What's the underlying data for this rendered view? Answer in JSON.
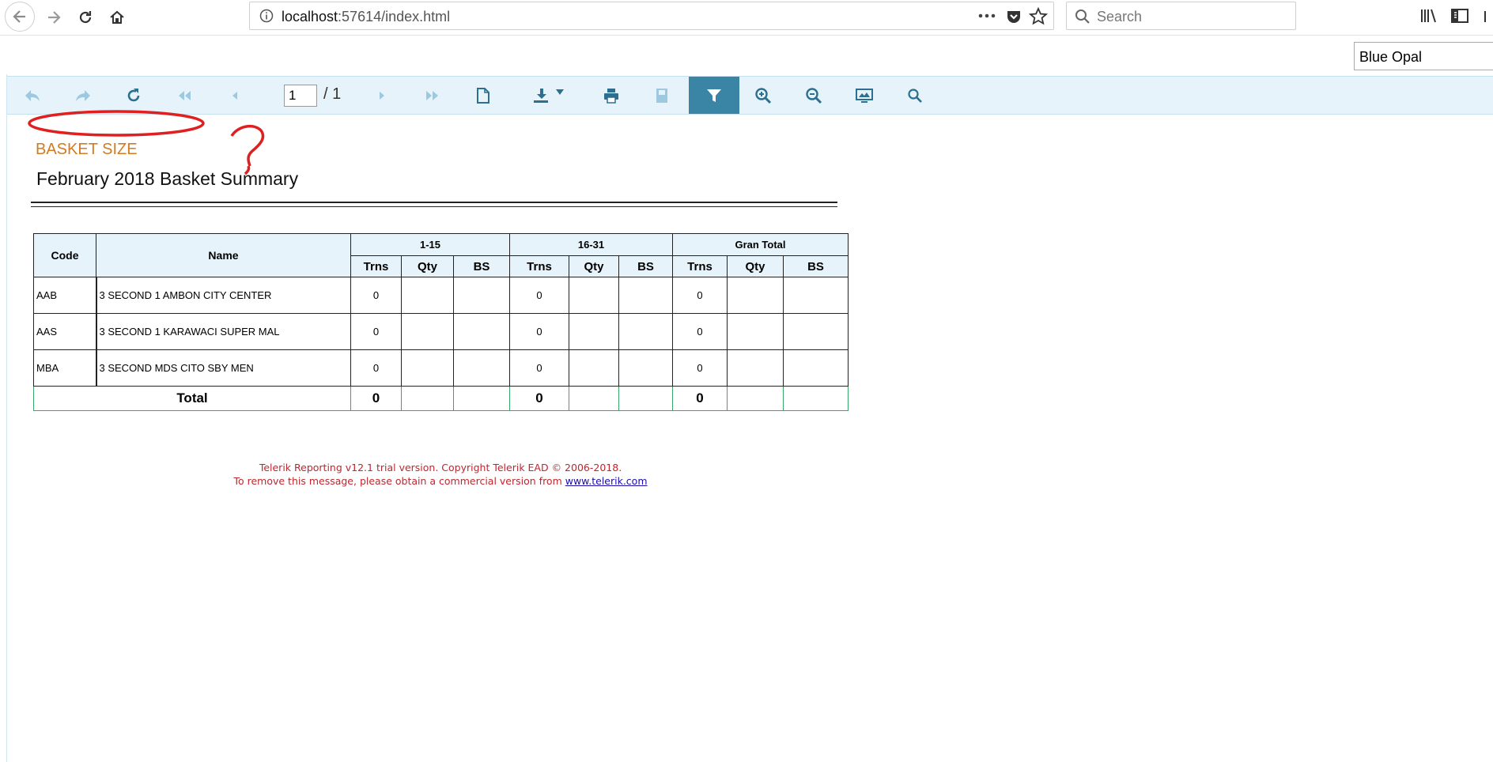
{
  "browser": {
    "url_host": "localhost",
    "url_rest": ":57614/index.html",
    "search_placeholder": "Search"
  },
  "theme_select": {
    "value": "Blue Opal"
  },
  "toolbar": {
    "page_current": "1",
    "page_total": "/ 1",
    "buttons": [
      "back-icon",
      "forward-icon",
      "refresh-icon",
      "first-page-icon",
      "previous-page-icon",
      "next-page-icon",
      "last-page-icon",
      "toggle-print-preview-icon",
      "export-icon",
      "print-icon",
      "document-map-icon",
      "parameters-icon",
      "zoom-in-icon",
      "zoom-out-icon",
      "scale-mode-icon",
      "search-icon"
    ]
  },
  "report": {
    "subtitle": "BASKET SIZE",
    "title": "February 2018 Basket Summary",
    "columns": {
      "code": "Code",
      "name": "Name",
      "groups": [
        "1-15",
        "16-31",
        "Gran Total"
      ],
      "sub": [
        "Trns",
        "Qty",
        "BS"
      ]
    },
    "rows": [
      {
        "code": "AAB",
        "name": "3 SECOND 1 AMBON CITY CENTER",
        "trns1": "0",
        "trns2": "0",
        "trns3": "0"
      },
      {
        "code": "AAS",
        "name": "3 SECOND 1 KARAWACI SUPER MAL",
        "trns1": "0",
        "trns2": "0",
        "trns3": "0"
      },
      {
        "code": "MBA",
        "name": "3 SECOND MDS CITO SBY MEN",
        "trns1": "0",
        "trns2": "0",
        "trns3": "0"
      }
    ],
    "total": {
      "label": "Total",
      "trns1": "0",
      "trns2": "0",
      "trns3": "0"
    },
    "trial_line1": "Telerik Reporting v12.1 trial version. Copyright Telerik EAD © 2006-2018.",
    "trial_line2": "To remove this message, please obtain a commercial version from ",
    "trial_link": "www.telerik.com"
  },
  "annotation": {
    "color": "#e02020",
    "mark": "?"
  }
}
